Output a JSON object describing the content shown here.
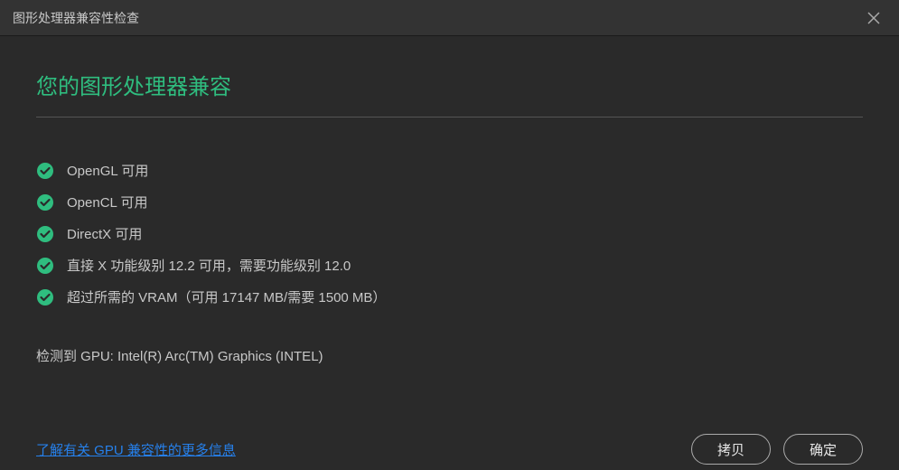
{
  "window": {
    "title": "图形处理器兼容性检查"
  },
  "heading": "您的图形处理器兼容",
  "checks": [
    {
      "label": "OpenGL 可用"
    },
    {
      "label": "OpenCL 可用"
    },
    {
      "label": "DirectX 可用"
    },
    {
      "label": "直接 X 功能级别 12.2 可用，需要功能级别 12.0"
    },
    {
      "label": "超过所需的 VRAM（可用 17147 MB/需要 1500 MB）"
    }
  ],
  "gpu_info": "检测到 GPU: Intel(R) Arc(TM) Graphics (INTEL)",
  "link_text": "了解有关 GPU 兼容性的更多信息",
  "buttons": {
    "copy": "拷贝",
    "ok": "确定"
  }
}
